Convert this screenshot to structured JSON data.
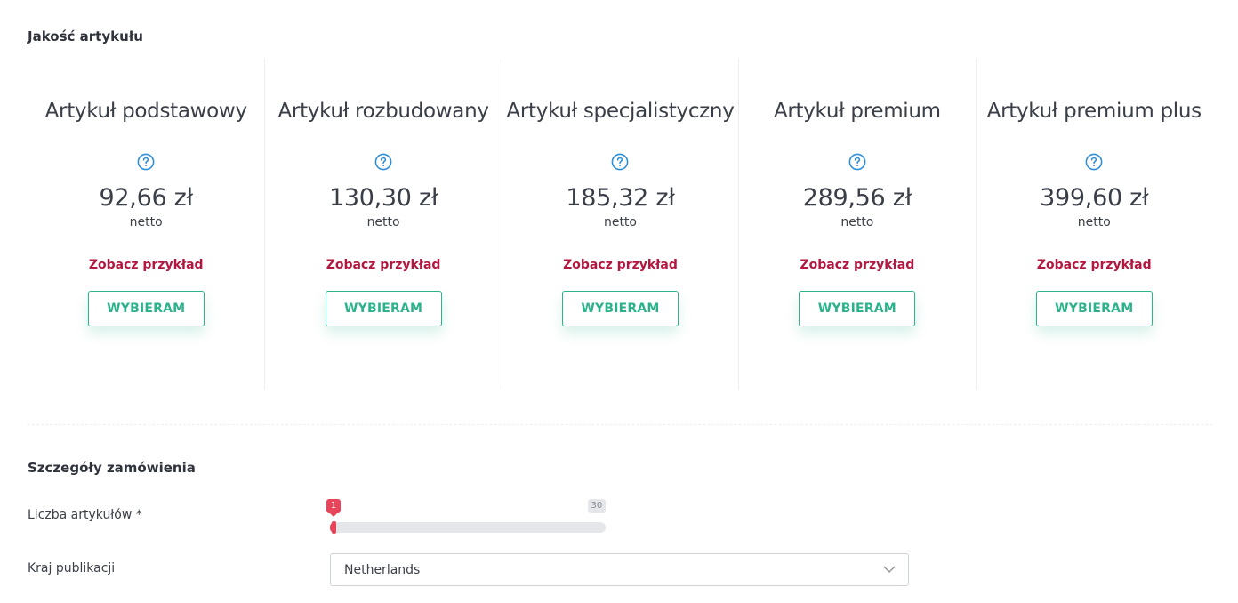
{
  "quality": {
    "title": "Jakość artykułu",
    "plans": [
      {
        "name": "Artykuł podstawowy",
        "price": "92,66 zł",
        "note": "netto",
        "example": "Zobacz przykład",
        "button": "WYBIERAM"
      },
      {
        "name": "Artykuł rozbudowany",
        "price": "130,30 zł",
        "note": "netto",
        "example": "Zobacz przykład",
        "button": "WYBIERAM"
      },
      {
        "name": "Artykuł specjalistyczny",
        "price": "185,32 zł",
        "note": "netto",
        "example": "Zobacz przykład",
        "button": "WYBIERAM"
      },
      {
        "name": "Artykuł premium",
        "price": "289,56 zł",
        "note": "netto",
        "example": "Zobacz przykład",
        "button": "WYBIERAM"
      },
      {
        "name": "Artykuł premium plus",
        "price": "399,60 zł",
        "note": "netto",
        "example": "Zobacz przykład",
        "button": "WYBIERAM"
      }
    ]
  },
  "details": {
    "title": "Szczegóły zamówienia",
    "count": {
      "label": "Liczba artykułów *",
      "value": "1",
      "min": "1",
      "max": "30"
    },
    "country": {
      "label": "Kraj publikacji",
      "value": "Netherlands"
    }
  },
  "colors": {
    "accent_green": "#2cb38b",
    "link_red": "#b3163e",
    "slider_red": "#e8455a",
    "help_blue": "#2f8fd8"
  },
  "icons": {
    "help": "question-circle-icon",
    "select": "chevron-down-icon"
  }
}
